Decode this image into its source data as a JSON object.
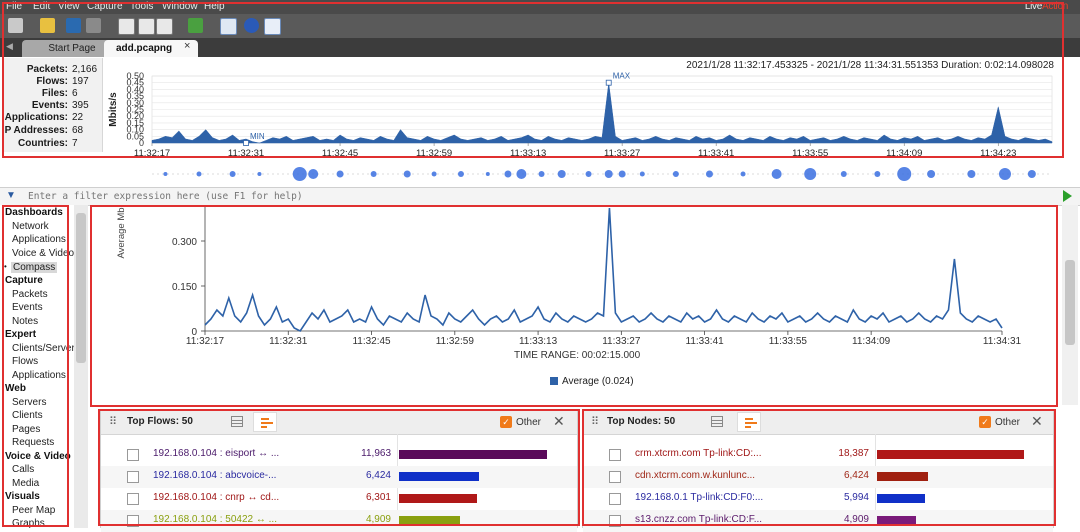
{
  "menubar": {
    "items": [
      "File",
      "Edit",
      "View",
      "Capture",
      "Tools",
      "Window",
      "Help"
    ],
    "brand_a": "Live",
    "brand_b": "Action"
  },
  "tabs": [
    {
      "label": "Start Page",
      "active": false
    },
    {
      "label": "add.pcapng",
      "active": true
    }
  ],
  "tab_close": "×",
  "summary": [
    {
      "label": "Packets:",
      "value": "2,166"
    },
    {
      "label": "Flows:",
      "value": "197"
    },
    {
      "label": "Files:",
      "value": "6"
    },
    {
      "label": "Events:",
      "value": "395"
    },
    {
      "label": "Applications:",
      "value": "22"
    },
    {
      "label": "IP Addresses:",
      "value": "68"
    },
    {
      "label": "Countries:",
      "value": "7"
    }
  ],
  "overview_range": "2021/1/28 11:32:17.453325 - 2021/1/28 11:34:31.551353  Duration: 0:02:14.098028",
  "filter": {
    "placeholder": "Enter a filter expression here (use F1 for help)",
    "icon": "filter-icon"
  },
  "sidebar": [
    {
      "section": "Dashboards",
      "items": [
        "Network",
        "Applications",
        "Voice & Video",
        "Compass"
      ],
      "active": "Compass"
    },
    {
      "section": "Capture",
      "items": [
        "Packets",
        "Events",
        "Notes"
      ]
    },
    {
      "section": "Expert",
      "items": [
        "Clients/Servers",
        "Flows",
        "Applications"
      ]
    },
    {
      "section": "Web",
      "items": [
        "Servers",
        "Clients",
        "Pages",
        "Requests"
      ]
    },
    {
      "section": "Voice & Video",
      "items": [
        "Calls",
        "Media"
      ]
    },
    {
      "section": "Visuals",
      "items": [
        "Peer Map",
        "Graphs"
      ]
    }
  ],
  "colors": {
    "accent": "#2e62a8",
    "highlight_box": "#e03030",
    "orange": "#f07a1a",
    "event_dot": "#3a6ee0"
  },
  "chart_data": [
    {
      "name": "overview",
      "type": "area",
      "ylabel": "Mbits/s",
      "ylim": [
        0,
        0.5
      ],
      "yticks": [
        0,
        0.05,
        0.1,
        0.15,
        0.2,
        0.25,
        0.3,
        0.35,
        0.4,
        0.45,
        0.5
      ],
      "ytick_labels": [
        "0",
        "0.05",
        "0.10",
        "0.15",
        "0.20",
        "0.25",
        "0.30",
        "0.35",
        "0.40",
        "0.45",
        "0.50"
      ],
      "xlim_s": [
        0,
        134
      ],
      "xtick_labels": [
        "11:32:17",
        "11:32:31",
        "11:32:45",
        "11:32:59",
        "11:33:13",
        "11:33:27",
        "11:33:41",
        "11:33:55",
        "11:34:09",
        "11:34:23"
      ],
      "xtick_s": [
        0,
        14,
        28,
        42,
        56,
        70,
        84,
        98,
        112,
        126
      ],
      "annotations": [
        {
          "text": "MIN",
          "x_s": 14,
          "y": 0
        },
        {
          "text": "MAX",
          "x_s": 68,
          "y": 0.45
        }
      ],
      "values": [
        0.02,
        0.03,
        0.05,
        0.04,
        0.09,
        0.03,
        0.02,
        0.05,
        0.1,
        0.04,
        0.02,
        0.03,
        0.06,
        0.02,
        0.03,
        0.01,
        0.0,
        0.02,
        0.04,
        0.03,
        0.05,
        0.02,
        0.03,
        0.04,
        0.05,
        0.02,
        0.03,
        0.02,
        0.06,
        0.03,
        0.02,
        0.04,
        0.03,
        0.02,
        0.05,
        0.03,
        0.02,
        0.1,
        0.04,
        0.03,
        0.02,
        0.05,
        0.03,
        0.02,
        0.04,
        0.06,
        0.03,
        0.02,
        0.03,
        0.04,
        0.02,
        0.03,
        0.05,
        0.02,
        0.03,
        0.04,
        0.06,
        0.03,
        0.02,
        0.05,
        0.03,
        0.02,
        0.04,
        0.03,
        0.02,
        0.03,
        0.05,
        0.04,
        0.45,
        0.05,
        0.02,
        0.03,
        0.04,
        0.02,
        0.03,
        0.05,
        0.03,
        0.02,
        0.04,
        0.03,
        0.02,
        0.05,
        0.03,
        0.04,
        0.02,
        0.03,
        0.06,
        0.03,
        0.02,
        0.04,
        0.03,
        0.02,
        0.05,
        0.03,
        0.02,
        0.04,
        0.03,
        0.05,
        0.02,
        0.03,
        0.04,
        0.02,
        0.03,
        0.05,
        0.03,
        0.02,
        0.04,
        0.03,
        0.02,
        0.06,
        0.03,
        0.02,
        0.04,
        0.03,
        0.05,
        0.02,
        0.03,
        0.04,
        0.02,
        0.03,
        0.05,
        0.03,
        0.02,
        0.04,
        0.03,
        0.06,
        0.27,
        0.05,
        0.03,
        0.02,
        0.04,
        0.03,
        0.02,
        0.03,
        0.01
      ]
    },
    {
      "name": "events",
      "type": "scatter",
      "xlim_s": [
        0,
        134
      ],
      "points": [
        {
          "x_s": 2,
          "r": 2.0
        },
        {
          "x_s": 7,
          "r": 2.5
        },
        {
          "x_s": 12,
          "r": 3.0
        },
        {
          "x_s": 16,
          "r": 2.0
        },
        {
          "x_s": 22,
          "r": 7.0
        },
        {
          "x_s": 24,
          "r": 5.0
        },
        {
          "x_s": 28,
          "r": 3.5
        },
        {
          "x_s": 33,
          "r": 3.0
        },
        {
          "x_s": 38,
          "r": 3.5
        },
        {
          "x_s": 42,
          "r": 2.5
        },
        {
          "x_s": 46,
          "r": 3.0
        },
        {
          "x_s": 50,
          "r": 2.0
        },
        {
          "x_s": 53,
          "r": 3.5
        },
        {
          "x_s": 55,
          "r": 5.0
        },
        {
          "x_s": 58,
          "r": 3.0
        },
        {
          "x_s": 61,
          "r": 4.0
        },
        {
          "x_s": 65,
          "r": 3.0
        },
        {
          "x_s": 68,
          "r": 4.0
        },
        {
          "x_s": 70,
          "r": 3.5
        },
        {
          "x_s": 73,
          "r": 2.5
        },
        {
          "x_s": 78,
          "r": 3.0
        },
        {
          "x_s": 83,
          "r": 3.5
        },
        {
          "x_s": 88,
          "r": 2.5
        },
        {
          "x_s": 93,
          "r": 5.0
        },
        {
          "x_s": 98,
          "r": 6.0
        },
        {
          "x_s": 103,
          "r": 3.0
        },
        {
          "x_s": 108,
          "r": 3.0
        },
        {
          "x_s": 112,
          "r": 7.0
        },
        {
          "x_s": 116,
          "r": 4.0
        },
        {
          "x_s": 122,
          "r": 4.0
        },
        {
          "x_s": 127,
          "r": 6.0
        },
        {
          "x_s": 131,
          "r": 4.0
        }
      ]
    },
    {
      "name": "main",
      "type": "line",
      "ylabel": "Average Mb",
      "xlabel": "TIME RANGE: 00:02:15.000",
      "ylim": [
        0,
        0.42
      ],
      "yticks": [
        0,
        0.15,
        0.3
      ],
      "ytick_labels": [
        "0",
        "0.150",
        "0.300"
      ],
      "xlim_s": [
        0,
        134
      ],
      "xtick_labels": [
        "11:32:17",
        "11:32:31",
        "11:32:45",
        "11:32:59",
        "11:33:13",
        "11:33:27",
        "11:33:41",
        "11:33:55",
        "11:34:09",
        "11:34:31"
      ],
      "xtick_s": [
        0,
        14,
        28,
        42,
        56,
        70,
        84,
        98,
        112,
        134
      ],
      "series": [
        {
          "name": "Average (0.024)",
          "values": [
            0.02,
            0.04,
            0.07,
            0.05,
            0.11,
            0.05,
            0.03,
            0.06,
            0.12,
            0.05,
            0.02,
            0.04,
            0.08,
            0.03,
            0.04,
            0.01,
            0.0,
            0.03,
            0.06,
            0.04,
            0.07,
            0.03,
            0.04,
            0.05,
            0.07,
            0.03,
            0.04,
            0.03,
            0.08,
            0.04,
            0.02,
            0.05,
            0.04,
            0.03,
            0.06,
            0.04,
            0.03,
            0.12,
            0.05,
            0.04,
            0.02,
            0.06,
            0.04,
            0.03,
            0.05,
            0.07,
            0.04,
            0.02,
            0.04,
            0.05,
            0.03,
            0.04,
            0.07,
            0.03,
            0.04,
            0.05,
            0.08,
            0.04,
            0.03,
            0.06,
            0.04,
            0.03,
            0.05,
            0.04,
            0.03,
            0.04,
            0.06,
            0.05,
            0.41,
            0.06,
            0.03,
            0.04,
            0.05,
            0.03,
            0.04,
            0.06,
            0.04,
            0.03,
            0.05,
            0.04,
            0.03,
            0.06,
            0.04,
            0.05,
            0.03,
            0.04,
            0.07,
            0.04,
            0.03,
            0.05,
            0.04,
            0.03,
            0.06,
            0.04,
            0.03,
            0.05,
            0.04,
            0.06,
            0.03,
            0.04,
            0.05,
            0.03,
            0.04,
            0.06,
            0.04,
            0.03,
            0.05,
            0.04,
            0.03,
            0.07,
            0.04,
            0.03,
            0.05,
            0.04,
            0.06,
            0.03,
            0.04,
            0.05,
            0.03,
            0.04,
            0.06,
            0.04,
            0.03,
            0.05,
            0.04,
            0.07,
            0.24,
            0.06,
            0.04,
            0.03,
            0.05,
            0.04,
            0.03,
            0.04,
            0.01
          ]
        }
      ]
    }
  ],
  "panels": {
    "flows": {
      "title": "Top Flows: 50",
      "other_label": "Other",
      "max": 12500,
      "rows": [
        {
          "name": "192.168.0.104 : eisport ↔ ...",
          "value": "11,963",
          "num": 11963,
          "color": "#5a0a5a",
          "text_color": "#4a1a6a"
        },
        {
          "name": "192.168.0.104 : abcvoice-...",
          "value": "6,424",
          "num": 6424,
          "color": "#1030c8",
          "text_color": "#2a2aa0"
        },
        {
          "name": "192.168.0.104 : cnrp ↔ cd...",
          "value": "6,301",
          "num": 6301,
          "color": "#b01818",
          "text_color": "#a01818"
        },
        {
          "name": "192.168.0.104 : 50422 ↔ ...",
          "value": "4,909",
          "num": 4909,
          "color": "#8aa010",
          "text_color": "#8aa010"
        }
      ]
    },
    "nodes": {
      "title": "Top Nodes: 50",
      "other_label": "Other",
      "max": 19000,
      "rows": [
        {
          "name": "crm.xtcrm.com Tp-link:CD:...",
          "value": "18,387",
          "num": 18387,
          "color": "#b01818",
          "text_color": "#a01818"
        },
        {
          "name": "cdn.xtcrm.com.w.kunlunc...",
          "value": "6,424",
          "num": 6424,
          "color": "#a02010",
          "text_color": "#a02818"
        },
        {
          "name": "192.168.0.1 Tp-link:CD:F0:...",
          "value": "5,994",
          "num": 5994,
          "color": "#1030c8",
          "text_color": "#2a2aa0"
        },
        {
          "name": "s13.cnzz.com Tp-link:CD:F...",
          "value": "4,909",
          "num": 4909,
          "color": "#7a1a7a",
          "text_color": "#5a1a6a"
        }
      ]
    }
  }
}
